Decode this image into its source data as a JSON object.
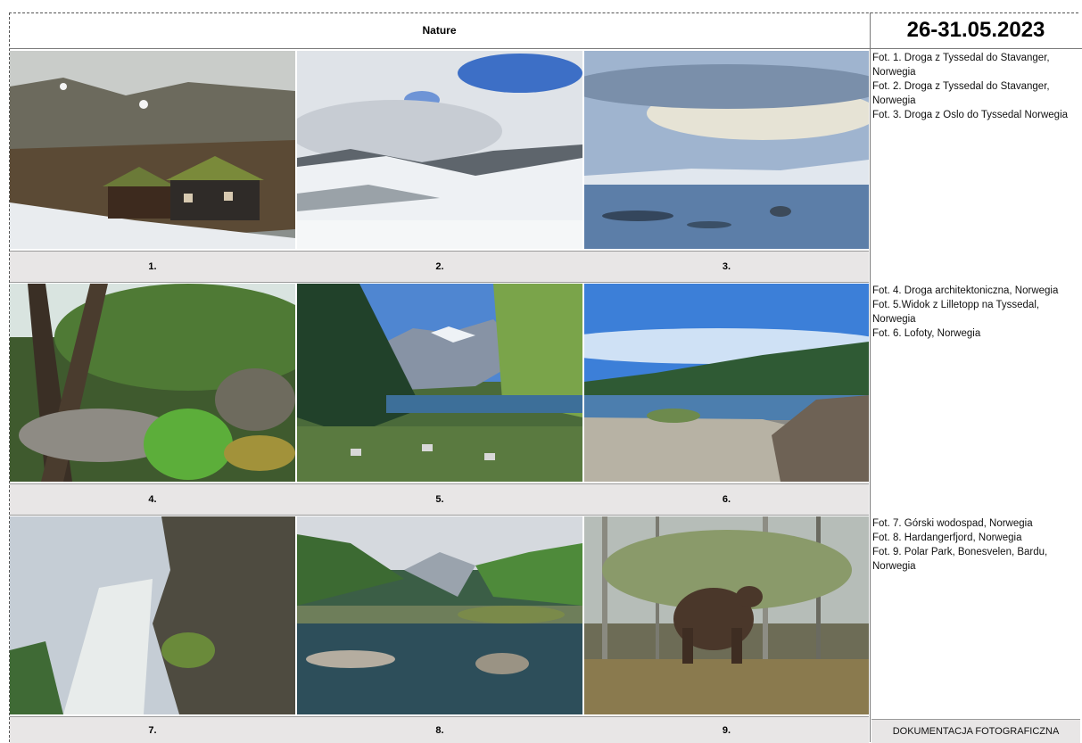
{
  "header": {
    "title": "Nature",
    "date": "26-31.05.2023"
  },
  "rows": [
    {
      "labels": [
        "1.",
        "2.",
        "3."
      ],
      "captions": [
        "Fot. 1. Droga z Tyssedal do Stavanger, Norwegia",
        "Fot. 2.  Droga z Tyssedal do Stavanger, Norwegia",
        "Fot. 3.  Droga z Oslo do Tyssedal Norwegia"
      ]
    },
    {
      "labels": [
        "4.",
        "5.",
        "6."
      ],
      "captions": [
        "Fot. 4. Droga architektoniczna, Norwegia",
        "Fot. 5.Widok z Lilletopp na Tyssedal, Norwegia",
        "Fot. 6. Lofoty, Norwegia"
      ]
    },
    {
      "labels": [
        "7.",
        "8.",
        "9."
      ],
      "captions": [
        "Fot. 7. Górski wodospad, Norwegia",
        "Fot. 8. Hardangerfjord, Norwegia",
        "Fot. 9. Polar Park, Bonesvelen, Bardu, Norwegia"
      ]
    }
  ],
  "footer": {
    "label": "DOKUMENTACJA FOTOGRAFICZNA"
  },
  "photos": [
    "mountain-cabin-photo",
    "snowy-valley-photo",
    "frozen-lake-photo",
    "forest-trail-photo",
    "fjord-valley-photo",
    "lake-shore-photo",
    "waterfall-photo",
    "mirror-lake-photo",
    "bear-forest-photo"
  ]
}
